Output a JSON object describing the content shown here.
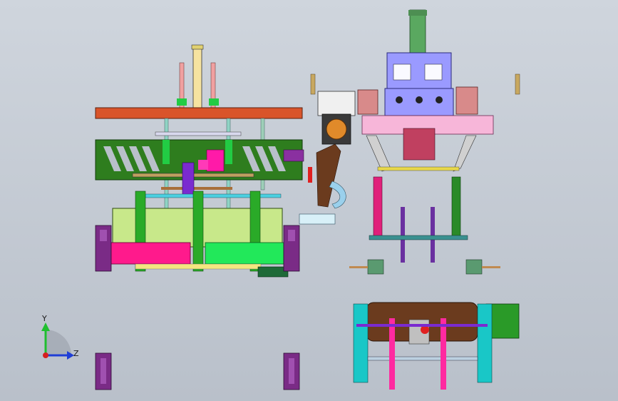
{
  "view": {
    "background_top": "#cfd5dd",
    "background_bottom": "#b9c0ca"
  },
  "triad": {
    "y_label": "Y",
    "z_label": "Z",
    "y_color": "#1fbf2f",
    "z_color": "#1f3ed6",
    "origin_color": "#d61f1f"
  },
  "assemblies": {
    "left": "front-press-assembly",
    "right_top": "gripper-cylinder-assembly",
    "right_bottom": "roller-drive-assembly"
  },
  "colors": {
    "frame_green": "#2e7d1e",
    "plate_orange": "#d9542a",
    "lime": "#c8e88a",
    "magenta": "#ff1a8c",
    "bright_green": "#22e85a",
    "purple": "#7a2b86",
    "lavender": "#9a9aff",
    "pink_light": "#f7b6d9",
    "cyan": "#19c7c7",
    "brown": "#6b3b1e"
  }
}
